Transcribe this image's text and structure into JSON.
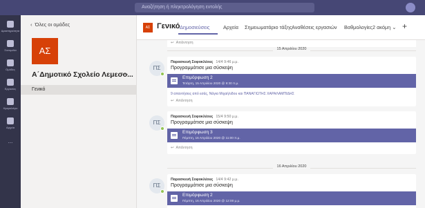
{
  "topbar": {
    "search_placeholder": "Αναζήτηση ή πληκτρολόγηση εντολής"
  },
  "rail": {
    "items": [
      {
        "label": "Δραστηριότητα"
      },
      {
        "label": "Συνομιλία"
      },
      {
        "label": "Ομάδες"
      },
      {
        "label": "Εργασίες"
      },
      {
        "label": "Ημερολόγιο"
      },
      {
        "label": "Αρχεία"
      },
      {
        "label": "..."
      }
    ]
  },
  "left": {
    "back_label": "Όλες οι ομάδες",
    "team_initials": "ΑΣ",
    "team_name": "Α΄Δημοτικό Σχολείο Λεμεσο...",
    "more": "···",
    "channel": "Γενικό"
  },
  "header": {
    "badge": "ΑΣ",
    "title": "Γενικό",
    "tabs": [
      {
        "label": "Δημοσιεύσεις"
      },
      {
        "label": "Αρχεία"
      },
      {
        "label": "Σημειωματάριο τάξης"
      },
      {
        "label": "Αναθέσεις εργασιών"
      },
      {
        "label": "Βαθμολογίες"
      },
      {
        "label": "2 ακόμη ⌄"
      }
    ],
    "plus": "+"
  },
  "feed": {
    "reply_label": "Απάντηση",
    "date_separators": [
      "15 Απριλίου 2020",
      "16 Απριλίου 2020"
    ],
    "posts": [
      {
        "initials": "ΠΣ",
        "author": "Παρασκευή Σοφοκλέους",
        "time": "14/4 9:46 μ.μ.",
        "action": "Προγραμμάτισε μια σύσκεψη",
        "meeting_title": "Επιμόρφωση 2",
        "meeting_date": "Τετάρτη, 15 Απριλίου 2020 @ 9:30 π.μ.",
        "replies_note": "9 απαντήσεις από εσάς, Νάγια Μιχαήλιδου και ΠΑΝΑΓΙΩΤΗΣ ΧΑΡΑΛΑΜΠΙΔΗΣ"
      },
      {
        "initials": "ΠΣ",
        "author": "Παρασκευή Σοφοκλέους",
        "time": "15/4 9:50 μ.μ.",
        "action": "Προγραμμάτισε μια σύσκεψη",
        "meeting_title": "Επιμόρφωση 3",
        "meeting_date": "Πέμπτη, 16 Απριλίου 2020 @ 11:00 π.μ."
      },
      {
        "initials": "ΠΣ",
        "author": "Παρασκευή Σοφοκλέους",
        "time": "14/4 9:42 μ.μ.",
        "action": "Προγραμμάτισε μια σύσκεψη",
        "meeting_title": "Επιμόρφωση 2",
        "meeting_date": "Πέμπτη, 16 Απριλίου 2020 @ 12:00 μ.μ."
      }
    ]
  }
}
